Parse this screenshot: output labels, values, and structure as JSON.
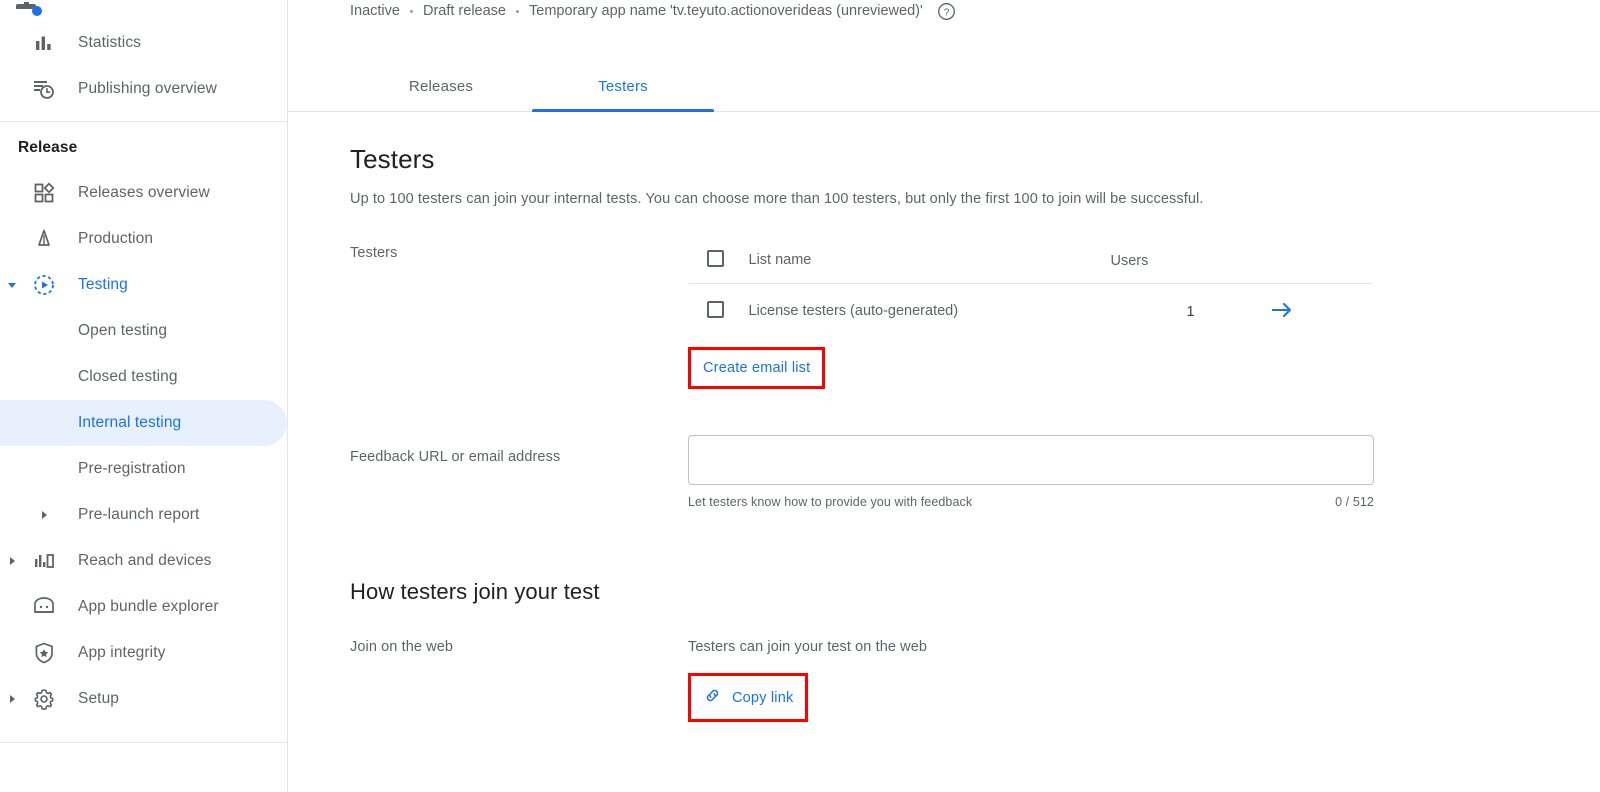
{
  "sidebar": {
    "items_top": [
      {
        "label": "Statistics",
        "icon": "bar-chart-icon",
        "state": "default"
      },
      {
        "label": "Publishing overview",
        "icon": "publishing-clock-icon",
        "state": "default"
      }
    ],
    "section_title": "Release",
    "items_release": [
      {
        "label": "Releases overview",
        "icon": "grid-diamond-icon",
        "state": "default",
        "caret": false
      },
      {
        "label": "Production",
        "icon": "rocket-icon",
        "state": "default",
        "caret": false
      },
      {
        "label": "Testing",
        "icon": "testing-play-icon",
        "state": "expanded-active",
        "caret": true
      },
      {
        "label": "Open testing",
        "icon": "",
        "state": "sub",
        "caret": false
      },
      {
        "label": "Closed testing",
        "icon": "",
        "state": "sub",
        "caret": false
      },
      {
        "label": "Internal testing",
        "icon": "",
        "state": "selected",
        "caret": false
      },
      {
        "label": "Pre-registration",
        "icon": "",
        "state": "sub",
        "caret": false
      },
      {
        "label": "Pre-launch report",
        "icon": "",
        "state": "sub",
        "caret": true
      },
      {
        "label": "Reach and devices",
        "icon": "reach-devices-icon",
        "state": "default",
        "caret": true
      },
      {
        "label": "App bundle explorer",
        "icon": "android-bundle-icon",
        "state": "default",
        "caret": false
      },
      {
        "label": "App integrity",
        "icon": "shield-star-icon",
        "state": "default",
        "caret": false
      },
      {
        "label": "Setup",
        "icon": "gear-icon",
        "state": "default",
        "caret": true
      }
    ]
  },
  "breadcrumb": {
    "status": "Inactive",
    "release": "Draft release",
    "app_name": "Temporary app name 'tv.teyuto.actionoverideas (unreviewed)'",
    "help_icon": "help-circle-icon"
  },
  "tabs": [
    {
      "label": "Releases",
      "active": false
    },
    {
      "label": "Testers",
      "active": true
    }
  ],
  "page": {
    "title": "Testers",
    "description": "Up to 100 testers can join your internal tests. You can choose more than 100 testers, but only the first 100 to join will be successful."
  },
  "testers_section": {
    "row_label": "Testers",
    "table": {
      "headers": [
        "List name",
        "Users"
      ],
      "rows": [
        {
          "name": "License testers (auto-generated)",
          "users": "1",
          "arrow_icon": "arrow-right-icon"
        }
      ]
    },
    "create_email_list_label": "Create email list"
  },
  "feedback_section": {
    "label": "Feedback URL or email address",
    "value": "",
    "placeholder": "",
    "helper": "Let testers know how to provide you with feedback",
    "counter": "0 / 512"
  },
  "join_section": {
    "title": "How testers join your test",
    "label": "Join on the web",
    "value": "Testers can join your test on the web",
    "copy_link_label": "Copy link",
    "copy_link_icon": "link-chain-icon"
  },
  "colors": {
    "accent": "#1a73e8",
    "selected_bg": "#e8f0fe",
    "annotation": "#ff0000",
    "text_primary": "#202124",
    "text_secondary": "#5f6368"
  }
}
